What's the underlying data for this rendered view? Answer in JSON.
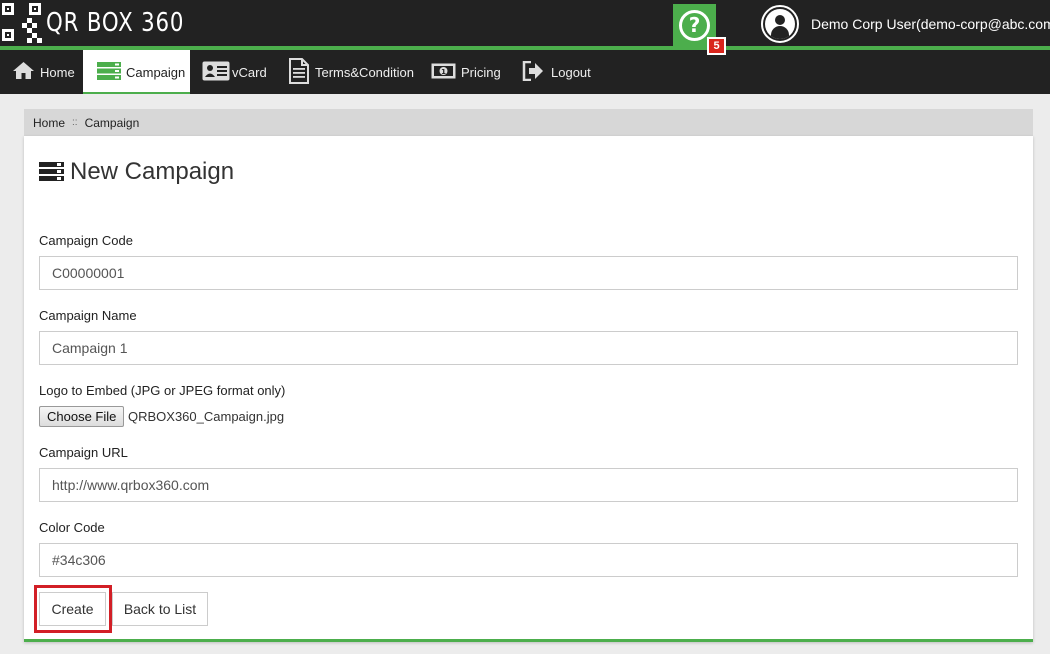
{
  "header": {
    "logo_text": "QR BOX 360",
    "help_icon_text": "?",
    "notification_count": "5",
    "user_name": "Demo Corp User(demo-corp@abc.com)"
  },
  "nav": {
    "items": [
      {
        "label": "Home",
        "icon": "home-icon"
      },
      {
        "label": "Campaign",
        "icon": "campaign-icon",
        "active": true
      },
      {
        "label": "vCard",
        "icon": "vcard-icon"
      },
      {
        "label": "Terms&Condition",
        "icon": "document-icon"
      },
      {
        "label": "Pricing",
        "icon": "money-icon"
      },
      {
        "label": "Logout",
        "icon": "logout-icon"
      }
    ]
  },
  "breadcrumb": {
    "home": "Home",
    "separator": "::",
    "current": "Campaign"
  },
  "form": {
    "title": "New Campaign",
    "campaign_code": {
      "label": "Campaign Code",
      "value": "C00000001"
    },
    "campaign_name": {
      "label": "Campaign Name",
      "value": "Campaign 1"
    },
    "logo": {
      "label": "Logo to Embed (JPG or JPEG format only)",
      "button_label": "Choose File",
      "file_name": "QRBOX360_Campaign.jpg"
    },
    "campaign_url": {
      "label": "Campaign URL",
      "value": "http://www.qrbox360.com"
    },
    "color_code": {
      "label": "Color Code",
      "value": "#34c306"
    },
    "create_label": "Create",
    "back_label": "Back to List"
  },
  "colors": {
    "accent": "#4cae4c",
    "header_bg": "#222222",
    "badge": "#d9251c",
    "highlight": "#d21f26"
  }
}
